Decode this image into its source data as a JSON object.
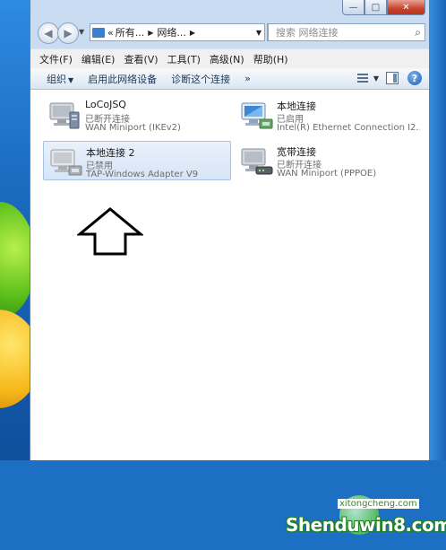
{
  "window": {
    "caption": {
      "minimize": "—",
      "maximize": "□",
      "close": "✕"
    }
  },
  "address": {
    "segments": [
      "所有...",
      "网络..."
    ],
    "leading": "«",
    "search_placeholder": "搜索 网络连接"
  },
  "menu": [
    "文件(F)",
    "编辑(E)",
    "查看(V)",
    "工具(T)",
    "高级(N)",
    "帮助(H)"
  ],
  "commands": {
    "organize": "组织",
    "disable": "启用此网络设备",
    "diagnose": "诊断这个连接",
    "more": "»"
  },
  "connections": [
    {
      "name": "LoCoJSQ",
      "status": "已断开连接",
      "adapter": "WAN Miniport (IKEv2)",
      "icon": "vpn-connection-icon"
    },
    {
      "name": "本地连接",
      "status": "已启用",
      "adapter": "Intel(R) Ethernet Connection I2...",
      "icon": "lan-connection-icon"
    },
    {
      "name": "本地连接 2",
      "status": "已禁用",
      "adapter": "TAP-Windows Adapter V9",
      "icon": "disabled-connection-icon",
      "selected": true
    },
    {
      "name": "宽带连接",
      "status": "已断开连接",
      "adapter": "WAN Miniport (PPPOE)",
      "icon": "broadband-connection-icon"
    }
  ],
  "watermark": {
    "main": "Shenduwin8.com",
    "sub": "xitongcheng.com"
  },
  "colors": {
    "selection": "#d7e5f6",
    "window_frame": "#c9dcf1",
    "command_bar": "#dbe6f3"
  }
}
